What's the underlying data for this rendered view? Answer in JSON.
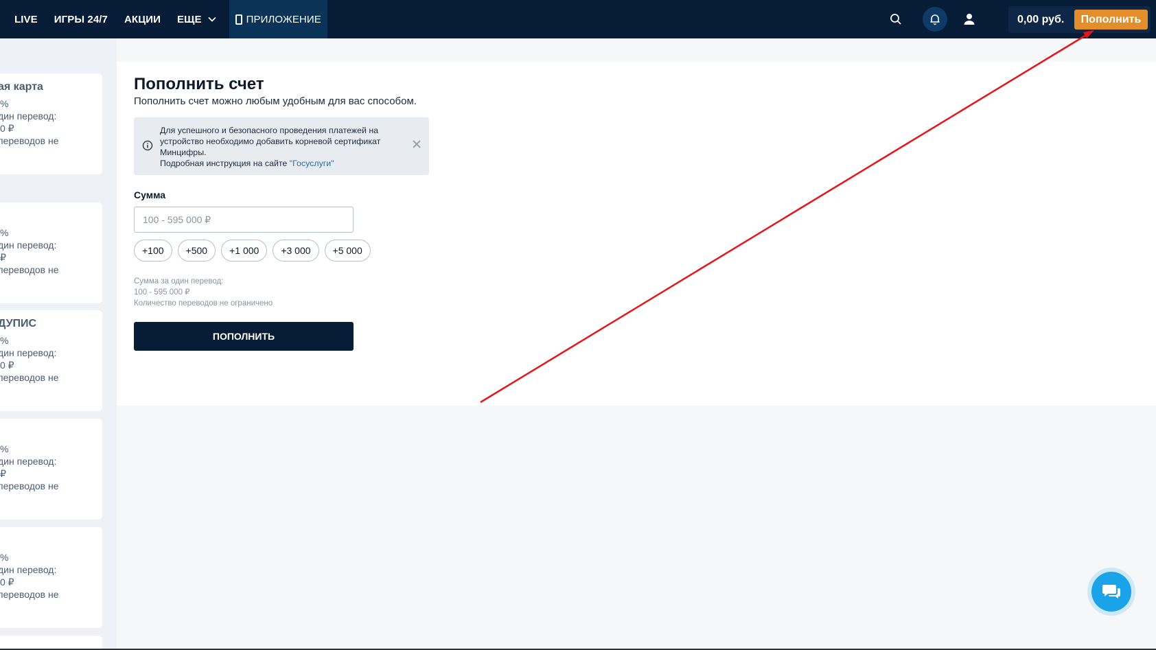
{
  "nav": {
    "items": [
      "LIVE",
      "ИГРЫ 24/7",
      "АКЦИИ",
      "ЕЩЕ"
    ],
    "app_label": "ПРИЛОЖЕНИЕ"
  },
  "header": {
    "balance": "0,00 руб.",
    "topup_label": "Пополнить"
  },
  "payment_methods": [
    {
      "title": "ая карта",
      "lines": [
        "%",
        "дин перевод:",
        "0 ₽",
        " переводов не"
      ]
    },
    {
      "title": "",
      "lines": [
        "%",
        "дин перевод:",
        "₽",
        " переводов не"
      ]
    },
    {
      "title": "ДУПИС",
      "lines": [
        "%",
        "дин перевод:",
        "0 ₽",
        " переводов не"
      ]
    },
    {
      "title": "",
      "lines": [
        "%",
        "дин перевод:",
        "₽",
        " переводов не"
      ]
    },
    {
      "title": "",
      "lines": [
        "%",
        "дин перевод:",
        "0 ₽",
        " переводов не"
      ]
    }
  ],
  "main": {
    "title": "Пополнить счет",
    "subtitle": "Пополнить счет можно любым удобным для вас способом.",
    "notice": {
      "line1": "Для успешного и безопасного проведения платежей на устройство необходимо добавить корневой сертификат Минцифры.",
      "line2_prefix": "Подробная инструкция на сайте ",
      "link": "\"Госуслуги\""
    },
    "amount_label": "Сумма",
    "amount_placeholder": "100 - 595 000 ₽",
    "chips": [
      "+100",
      "+500",
      "+1 000",
      "+3 000",
      "+5 000"
    ],
    "limits": [
      "Сумма за один перевод:",
      "100 - 595 000 ₽",
      "Количество переводов не ограничено"
    ],
    "submit_label": "ПОПОЛНИТЬ"
  },
  "colors": {
    "topbar": "#071c37",
    "accent": "#e48e2b",
    "arrow": "#e8141a",
    "chat": "#1aa3e8"
  }
}
